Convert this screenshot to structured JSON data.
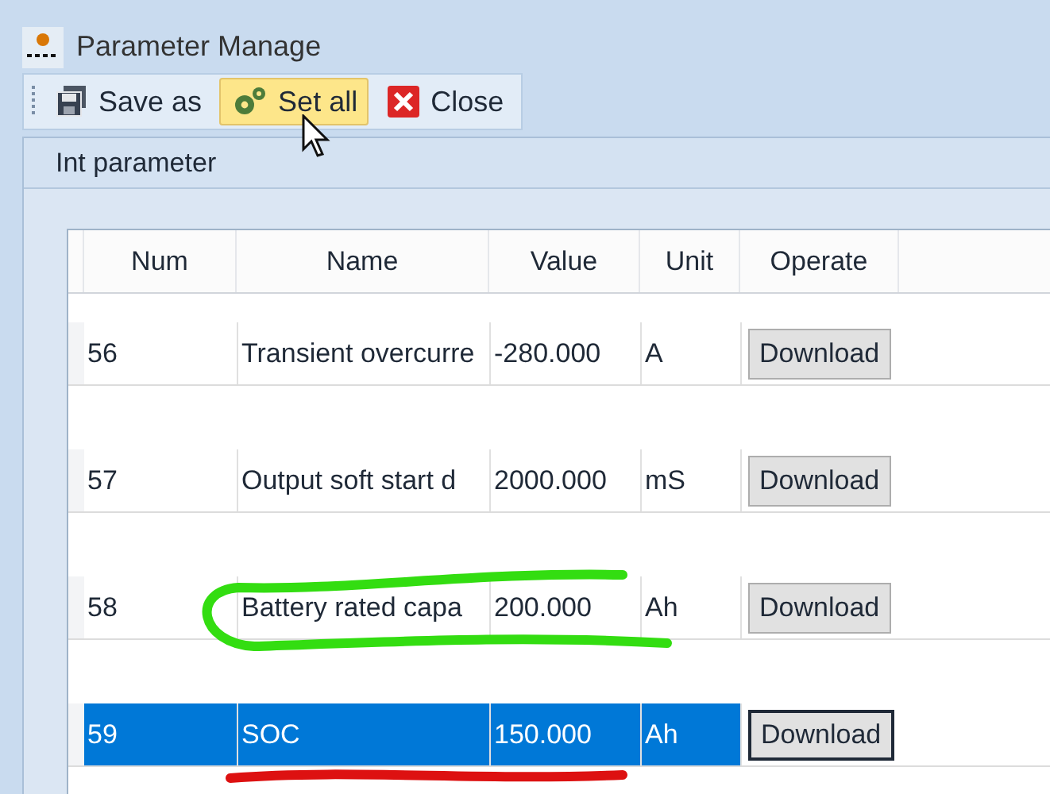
{
  "window": {
    "title": "Parameter Manage"
  },
  "toolbar": [
    {
      "kind": "save",
      "label": "Save as",
      "hovered": false
    },
    {
      "kind": "gear",
      "label": "Set all",
      "hovered": true
    },
    {
      "kind": "close",
      "label": "Close",
      "hovered": false
    }
  ],
  "tab": {
    "label": "Int parameter"
  },
  "table": {
    "columns": [
      "Num",
      "Name",
      "Value",
      "Unit",
      "Operate"
    ],
    "rows": [
      {
        "num": "56",
        "name": "Transient overcurre",
        "value": "-280.000",
        "unit": "A",
        "action": "Download",
        "selected": false
      },
      {
        "num": "57",
        "name": "Output soft start d",
        "value": "2000.000",
        "unit": "mS",
        "action": "Download",
        "selected": false
      },
      {
        "num": "58",
        "name": "Battery rated capa",
        "value": "200.000",
        "unit": "Ah",
        "action": "Download",
        "selected": false
      },
      {
        "num": "59",
        "name": "SOC",
        "value": "150.000",
        "unit": "Ah",
        "action": "Download",
        "selected": true
      }
    ]
  },
  "markups": [
    {
      "kind": "loop",
      "color": "#33dd11"
    },
    {
      "kind": "underline",
      "color": "#dd1111"
    }
  ]
}
